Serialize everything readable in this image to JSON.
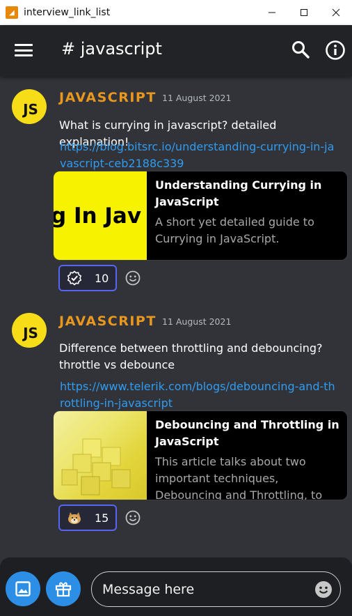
{
  "window": {
    "title": "interview_link_list",
    "app_icon": "app-icon"
  },
  "header": {
    "channel_title": "# javascript",
    "icons": [
      "menu-icon",
      "search-icon",
      "info-icon"
    ]
  },
  "messages": [
    {
      "author": "JAVASCRIPT",
      "avatar_text": "JS",
      "date": "11 August 2021",
      "text": "What is currying in javascript? detailed explanation!",
      "link": "https://blog.bitsrc.io/understanding-currying-in-javascript-ceb2188c339",
      "embed": {
        "thumb_text": "g In Jav",
        "title": "Understanding Currying in JavaScript",
        "description": "A short yet detailed guide to Currying in JavaScript."
      },
      "reaction": {
        "emoji": "verified-badge-icon",
        "count": "10"
      }
    },
    {
      "author": "JAVASCRIPT",
      "avatar_text": "JS",
      "date": "11 August 2021",
      "text": "Difference between throttling and debouncing? throttle vs debounce",
      "link": "https://www.telerik.com/blogs/debouncing-and-throttling-in-javascript",
      "embed": {
        "thumb_text": "",
        "title": "Debouncing and Throttling in JavaScript",
        "description": "This article talks about two important techniques, Debouncing and Throttling, to enhance your ..."
      },
      "reaction": {
        "emoji": "doge-icon",
        "count": "15"
      }
    }
  ],
  "composer": {
    "placeholder": "Message here",
    "buttons": [
      "image-icon",
      "gift-icon",
      "emoji-icon"
    ]
  },
  "colors": {
    "background": "#313338",
    "header": "#222326",
    "author": "#e8971f",
    "link": "#2f9cf2",
    "reaction_border": "#5865f2",
    "composer_button": "#2d8ee6",
    "avatar": "#f6dd18"
  }
}
